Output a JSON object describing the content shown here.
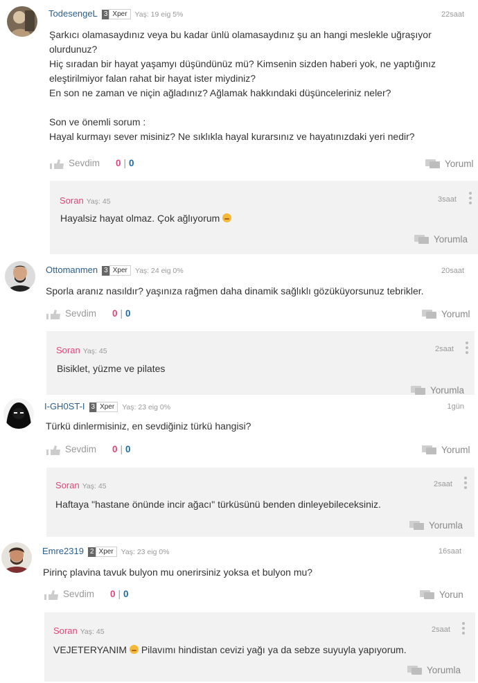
{
  "ui": {
    "like_label": "Sevdim",
    "reply_label": "Yorumla",
    "xper": "Xper",
    "sep": "|"
  },
  "questions": [
    {
      "user": "TodesengeL",
      "level": "3",
      "meta": "Yaş: 19 eig 5%",
      "time": "22saat",
      "text": "Şarkıcı olamasaydınız veya bu kadar ünlü olamasaydınız şu an hangi meslekle uğraşıyor olurdunuz?\nHiç sıradan bir hayat yaşamyı düşündünüz mü? Kimsenin sizden haberi yok, ne yaptığınız eleştirilmiyor falan rahat bir hayat ister miydiniz?\nEn son ne zaman ve niçin ağladınız? Ağlamak hakkındaki düşünceleriniz neler?\n\nSon ve önemli sorum :\nHayal kurmayı sever misiniz? Ne sıklıkla hayal kurarsınız ve hayatınızdaki yeri nedir?",
      "likes_pink": "0",
      "likes_blue": "0",
      "reply_text": "Yoruml",
      "answer": {
        "user": "Soran",
        "meta": "Yaş: 45",
        "time": "3saat",
        "text": "Hayalsiz hayat olmaz. Çok ağlıyorum",
        "emoji": true,
        "emoji_after": "",
        "reply": "Yorumla"
      }
    },
    {
      "user": "Ottomanmen",
      "level": "3",
      "meta": "Yaş: 24 eig 0%",
      "time": "20saat",
      "text": "Sporla aranız nasıldır? yaşınıza rağmen daha dinamik sağlıklı gözüküyorsunuz tebrikler.",
      "likes_pink": "0",
      "likes_blue": "0",
      "reply_text": "Yoruml",
      "answer": {
        "user": "Soran",
        "meta": "Yaş: 45",
        "time": "2saat",
        "text": "Bisiklet, yüzme ve pilates",
        "emoji": false,
        "emoji_after": "",
        "reply": "Yorumla"
      }
    },
    {
      "user": "I-GH0ST-I",
      "level": "3",
      "meta": "Yaş: 23 eig 0%",
      "time": "1gün",
      "text": "Türkü dinlermisiniz, en sevdiğiniz türkü hangisi?",
      "likes_pink": "0",
      "likes_blue": "0",
      "reply_text": "Yoruml",
      "answer": {
        "user": "Soran",
        "meta": "Yaş: 45",
        "time": "2saat",
        "text": "Haftaya \"hastane önünde incir ağacı\" türküsünü benden dinleyebileceksiniz.",
        "emoji": false,
        "emoji_after": "",
        "reply": "Yorumla"
      }
    },
    {
      "user": "Emre2319",
      "level": "2",
      "meta": "Yaş: 23 eig 0%",
      "time": "16saat",
      "text": "Pirinç plavina tavuk bulyon mu onerirsiniz yoksa et bulyon mu?",
      "likes_pink": "0",
      "likes_blue": "0",
      "reply_text": "Yorun",
      "answer": {
        "user": "Soran",
        "meta": "Yaş: 45",
        "time": "2saat",
        "text": "VEJETERYANIM",
        "emoji": true,
        "emoji_after": " Pilavımı hindistan cevizi yağı ya da sebze suyuyla yapıyorum.",
        "reply": "Yorumla"
      }
    }
  ]
}
